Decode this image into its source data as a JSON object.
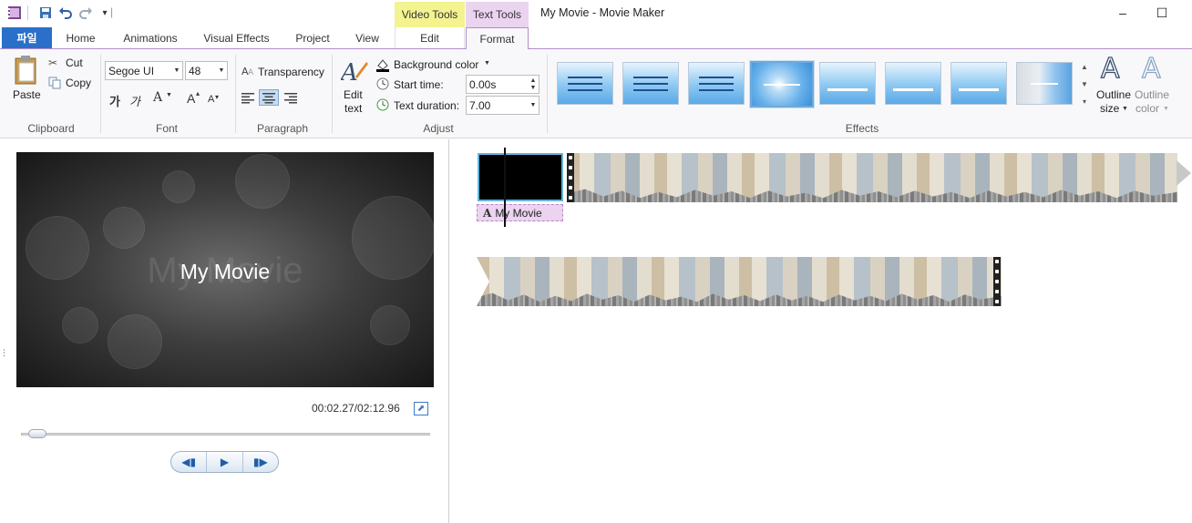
{
  "window": {
    "title": "My Movie - Movie Maker",
    "context_tab_video": "Video Tools",
    "context_tab_text": "Text Tools",
    "minimize_glyph": "–",
    "maximize_glyph": "☐"
  },
  "qat": {
    "dropdown_glyph": "▾",
    "divider": "|"
  },
  "tabs": {
    "file": "파일",
    "home": "Home",
    "animations": "Animations",
    "visual_effects": "Visual Effects",
    "project": "Project",
    "view": "View",
    "edit": "Edit",
    "format": "Format"
  },
  "clipboard": {
    "paste": "Paste",
    "cut": "Cut",
    "copy": "Copy",
    "group": "Clipboard"
  },
  "font": {
    "family": "Segoe UI",
    "size": "48",
    "korean_a": "가",
    "korean_b": "가",
    "color_glyph": "A",
    "grow": "A",
    "shrink": "A",
    "group": "Font"
  },
  "paragraph": {
    "transparency": "Transparency",
    "group": "Paragraph"
  },
  "adjust": {
    "edit_text_1": "Edit",
    "edit_text_2": "text",
    "background_color": "Background color",
    "start_time_label": "Start time:",
    "start_time_value": "0.00s",
    "text_duration_label": "Text duration:",
    "text_duration_value": "7.00",
    "group": "Adjust"
  },
  "effects": {
    "group": "Effects",
    "outline_size_1": "Outline",
    "outline_size_2": "size",
    "outline_color_1": "Outline",
    "outline_color_2": "color",
    "outline_glyph": "A"
  },
  "preview": {
    "title_text": "My Movie",
    "time": "00:02.27/02:12.96",
    "progress": 0.018
  },
  "storyboard": {
    "caption": "My Movie",
    "caption_icon": "A"
  },
  "colors": {
    "file_tab": "#2a6fc9",
    "video_tools": "#f3f390",
    "text_tools": "#ead4f0",
    "accent_blue": "#1f5fa8"
  }
}
